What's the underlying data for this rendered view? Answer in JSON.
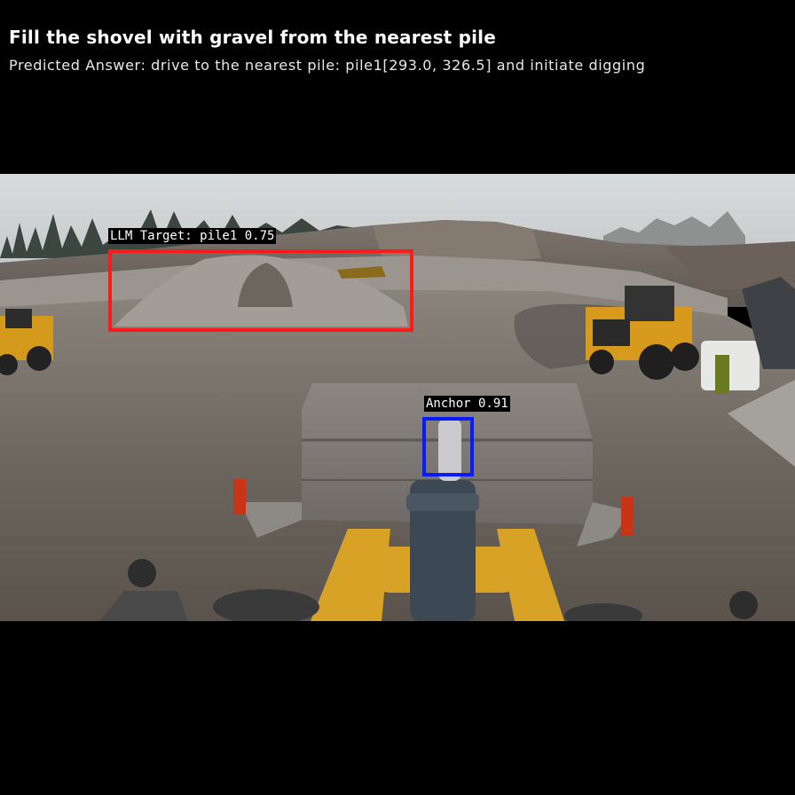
{
  "header": {
    "title": "Fill the shovel with gravel from the nearest pile",
    "answer": "Predicted Answer: drive to the nearest pile: pile1[293.0, 326.5] and initiate digging"
  },
  "detections": [
    {
      "label": "LLM Target: pile1 0.75",
      "color": "#ff1a1a"
    },
    {
      "label": "Anchor 0.91",
      "color": "#0a1aff"
    }
  ]
}
